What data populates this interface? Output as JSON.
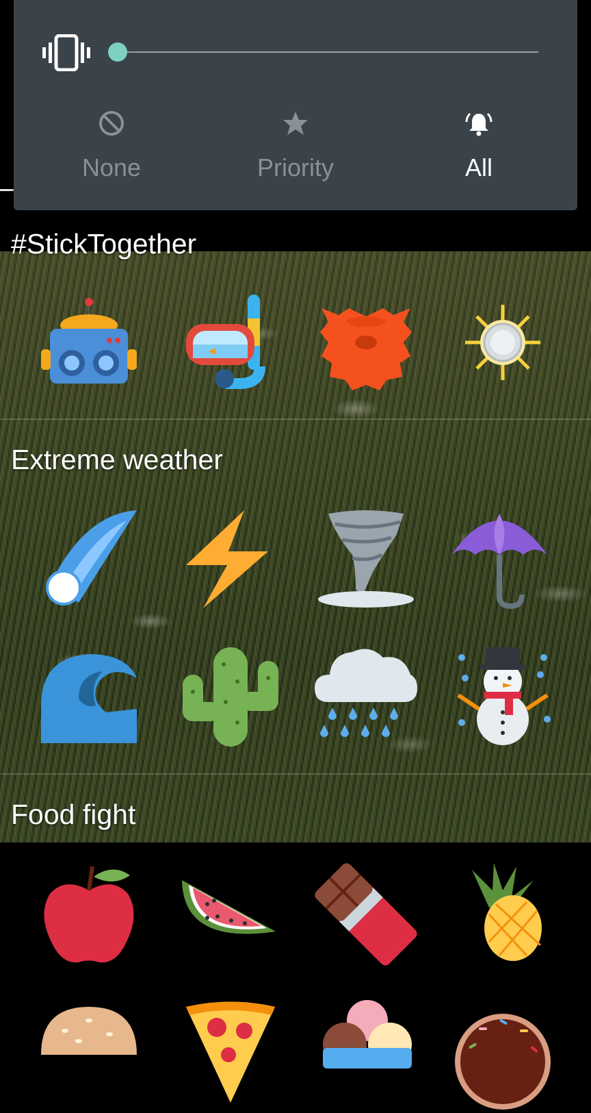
{
  "volume_panel": {
    "vibrate_icon": "vibrate-icon",
    "slider_level": 0,
    "accent_color": "#7dcfc2",
    "modes": [
      {
        "label": "None",
        "icon": "do-not-disturb-icon",
        "active": false
      },
      {
        "label": "Priority",
        "icon": "star-icon",
        "active": false
      },
      {
        "label": "All",
        "icon": "bell-ringing-icon",
        "active": true
      }
    ]
  },
  "sections": [
    {
      "title": "#StickTogether",
      "stickers": [
        "robot-vr-headset-sticker",
        "snorkel-mask-sticker",
        "red-beard-sticker",
        "sparkling-coin-sticker"
      ]
    },
    {
      "title": "Extreme weather",
      "stickers": [
        "comet-sticker",
        "lightning-sticker",
        "tornado-sticker",
        "umbrella-sticker",
        "wave-sticker",
        "cactus-sticker",
        "rain-cloud-sticker",
        "snowman-sticker"
      ]
    },
    {
      "title": "Food fight",
      "stickers": [
        "apple-sticker",
        "watermelon-sticker",
        "chocolate-bar-sticker",
        "pineapple-sticker",
        "burger-sticker",
        "pizza-sticker",
        "ice-cream-sticker",
        "donut-sticker"
      ]
    }
  ]
}
